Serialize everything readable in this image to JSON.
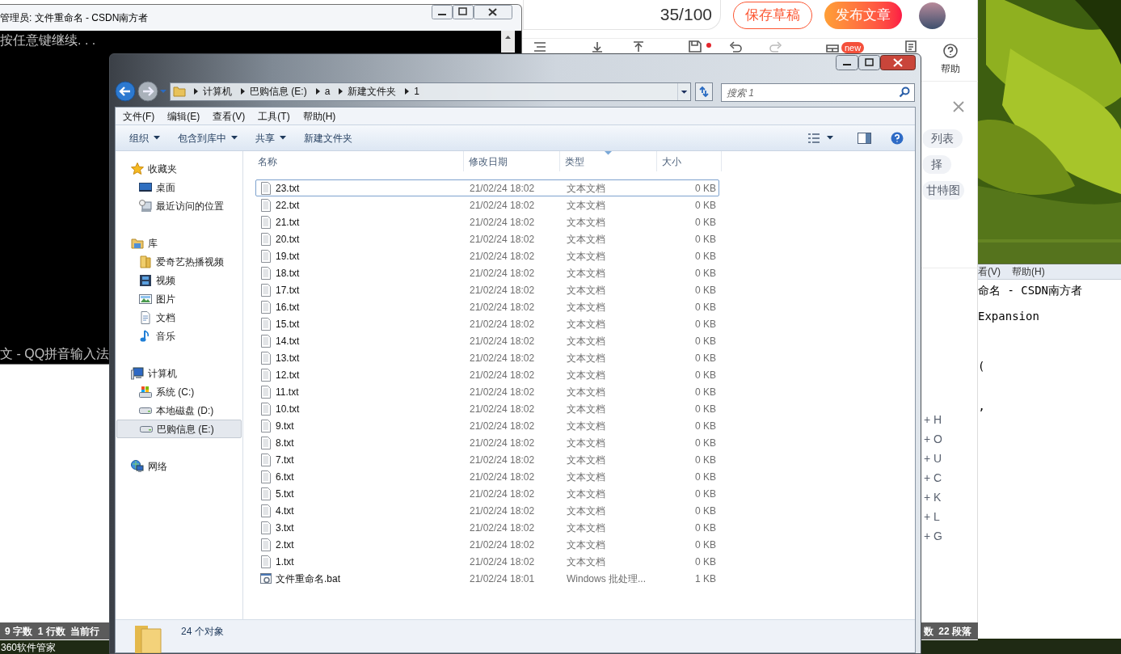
{
  "console_window": {
    "title": "管理员: 文件重命名 - CSDN南方者",
    "lines": [
      "按任意键继续. . ."
    ],
    "ime_status": "文 - QQ拼音输入法"
  },
  "editor": {
    "title_counter": "35/100",
    "buttons": [
      {
        "label": "保存草稿",
        "kind": "outline"
      },
      {
        "label": "发布文章",
        "kind": "primary"
      }
    ],
    "toolbar_badge": "new",
    "help_label": "帮助",
    "side_chips": [
      "列表",
      "择",
      "甘特图"
    ],
    "outline_items": [
      "+ H",
      "+ O",
      "+ U",
      "+ C",
      "+ K",
      "+ L",
      "+ G"
    ],
    "status_left": "9 字数  1 行数  当前行",
    "status_right": "数  22 段落"
  },
  "notepad_window": {
    "menu": [
      "看(V)",
      "帮助(H)"
    ],
    "lines": [
      "命名 - CSDN南方者",
      "Expansion",
      "(",
      "’"
    ]
  },
  "explorer": {
    "address": [
      "计算机",
      "巴购信息 (E:)",
      "a",
      "新建文件夹",
      "1"
    ],
    "search": {
      "placeholder": "搜索 1"
    },
    "menu": [
      "文件(F)",
      "编辑(E)",
      "查看(V)",
      "工具(T)",
      "帮助(H)"
    ],
    "toolbar": [
      {
        "label": "组织",
        "dropdown": true
      },
      {
        "label": "包含到库中",
        "dropdown": true
      },
      {
        "label": "共享",
        "dropdown": true
      },
      {
        "label": "新建文件夹",
        "dropdown": false
      }
    ],
    "nav": [
      {
        "label": "收藏夹",
        "kind": "star",
        "selected": false,
        "children": [
          {
            "label": "桌面",
            "kind": "desktop",
            "selected": false
          },
          {
            "label": "最近访问的位置",
            "kind": "recent",
            "selected": false
          }
        ]
      },
      {
        "label": "库",
        "kind": "library",
        "selected": false,
        "children": [
          {
            "label": "爱奇艺热播视频",
            "kind": "folder",
            "selected": false
          },
          {
            "label": "视频",
            "kind": "video",
            "selected": false
          },
          {
            "label": "图片",
            "kind": "picture",
            "selected": false
          },
          {
            "label": "文档",
            "kind": "document",
            "selected": false
          },
          {
            "label": "音乐",
            "kind": "music",
            "selected": false
          }
        ]
      },
      {
        "label": "计算机",
        "kind": "computer",
        "selected": false,
        "children": [
          {
            "label": "系统 (C:)",
            "kind": "system-drive",
            "selected": false
          },
          {
            "label": "本地磁盘 (D:)",
            "kind": "drive",
            "selected": false
          },
          {
            "label": "巴购信息 (E:)",
            "kind": "drive",
            "selected": true
          }
        ]
      },
      {
        "label": "网络",
        "kind": "network",
        "selected": false
      }
    ],
    "columns": [
      {
        "label": "名称",
        "sorted": false
      },
      {
        "label": "修改日期",
        "sorted": false
      },
      {
        "label": "类型",
        "sorted": true
      },
      {
        "label": "大小",
        "sorted": false
      }
    ],
    "files": [
      {
        "name": "23.txt",
        "modified": "21/02/24 18:02",
        "type": "文本文档",
        "size": "0 KB",
        "kind": "txt",
        "focused": true
      },
      {
        "name": "22.txt",
        "modified": "21/02/24 18:02",
        "type": "文本文档",
        "size": "0 KB",
        "kind": "txt",
        "focused": false
      },
      {
        "name": "21.txt",
        "modified": "21/02/24 18:02",
        "type": "文本文档",
        "size": "0 KB",
        "kind": "txt",
        "focused": false
      },
      {
        "name": "20.txt",
        "modified": "21/02/24 18:02",
        "type": "文本文档",
        "size": "0 KB",
        "kind": "txt",
        "focused": false
      },
      {
        "name": "19.txt",
        "modified": "21/02/24 18:02",
        "type": "文本文档",
        "size": "0 KB",
        "kind": "txt",
        "focused": false
      },
      {
        "name": "18.txt",
        "modified": "21/02/24 18:02",
        "type": "文本文档",
        "size": "0 KB",
        "kind": "txt",
        "focused": false
      },
      {
        "name": "17.txt",
        "modified": "21/02/24 18:02",
        "type": "文本文档",
        "size": "0 KB",
        "kind": "txt",
        "focused": false
      },
      {
        "name": "16.txt",
        "modified": "21/02/24 18:02",
        "type": "文本文档",
        "size": "0 KB",
        "kind": "txt",
        "focused": false
      },
      {
        "name": "15.txt",
        "modified": "21/02/24 18:02",
        "type": "文本文档",
        "size": "0 KB",
        "kind": "txt",
        "focused": false
      },
      {
        "name": "14.txt",
        "modified": "21/02/24 18:02",
        "type": "文本文档",
        "size": "0 KB",
        "kind": "txt",
        "focused": false
      },
      {
        "name": "13.txt",
        "modified": "21/02/24 18:02",
        "type": "文本文档",
        "size": "0 KB",
        "kind": "txt",
        "focused": false
      },
      {
        "name": "12.txt",
        "modified": "21/02/24 18:02",
        "type": "文本文档",
        "size": "0 KB",
        "kind": "txt",
        "focused": false
      },
      {
        "name": "11.txt",
        "modified": "21/02/24 18:02",
        "type": "文本文档",
        "size": "0 KB",
        "kind": "txt",
        "focused": false
      },
      {
        "name": "10.txt",
        "modified": "21/02/24 18:02",
        "type": "文本文档",
        "size": "0 KB",
        "kind": "txt",
        "focused": false
      },
      {
        "name": "9.txt",
        "modified": "21/02/24 18:02",
        "type": "文本文档",
        "size": "0 KB",
        "kind": "txt",
        "focused": false
      },
      {
        "name": "8.txt",
        "modified": "21/02/24 18:02",
        "type": "文本文档",
        "size": "0 KB",
        "kind": "txt",
        "focused": false
      },
      {
        "name": "7.txt",
        "modified": "21/02/24 18:02",
        "type": "文本文档",
        "size": "0 KB",
        "kind": "txt",
        "focused": false
      },
      {
        "name": "6.txt",
        "modified": "21/02/24 18:02",
        "type": "文本文档",
        "size": "0 KB",
        "kind": "txt",
        "focused": false
      },
      {
        "name": "5.txt",
        "modified": "21/02/24 18:02",
        "type": "文本文档",
        "size": "0 KB",
        "kind": "txt",
        "focused": false
      },
      {
        "name": "4.txt",
        "modified": "21/02/24 18:02",
        "type": "文本文档",
        "size": "0 KB",
        "kind": "txt",
        "focused": false
      },
      {
        "name": "3.txt",
        "modified": "21/02/24 18:02",
        "type": "文本文档",
        "size": "0 KB",
        "kind": "txt",
        "focused": false
      },
      {
        "name": "2.txt",
        "modified": "21/02/24 18:02",
        "type": "文本文档",
        "size": "0 KB",
        "kind": "txt",
        "focused": false
      },
      {
        "name": "1.txt",
        "modified": "21/02/24 18:02",
        "type": "文本文档",
        "size": "0 KB",
        "kind": "txt",
        "focused": false
      },
      {
        "name": "文件重命名.bat",
        "modified": "21/02/24 18:01",
        "type": "Windows 批处理...",
        "size": "1 KB",
        "kind": "bat",
        "focused": false
      }
    ],
    "status": "24 个对象"
  },
  "taskbar": {
    "items": [
      "360软件管家"
    ]
  }
}
